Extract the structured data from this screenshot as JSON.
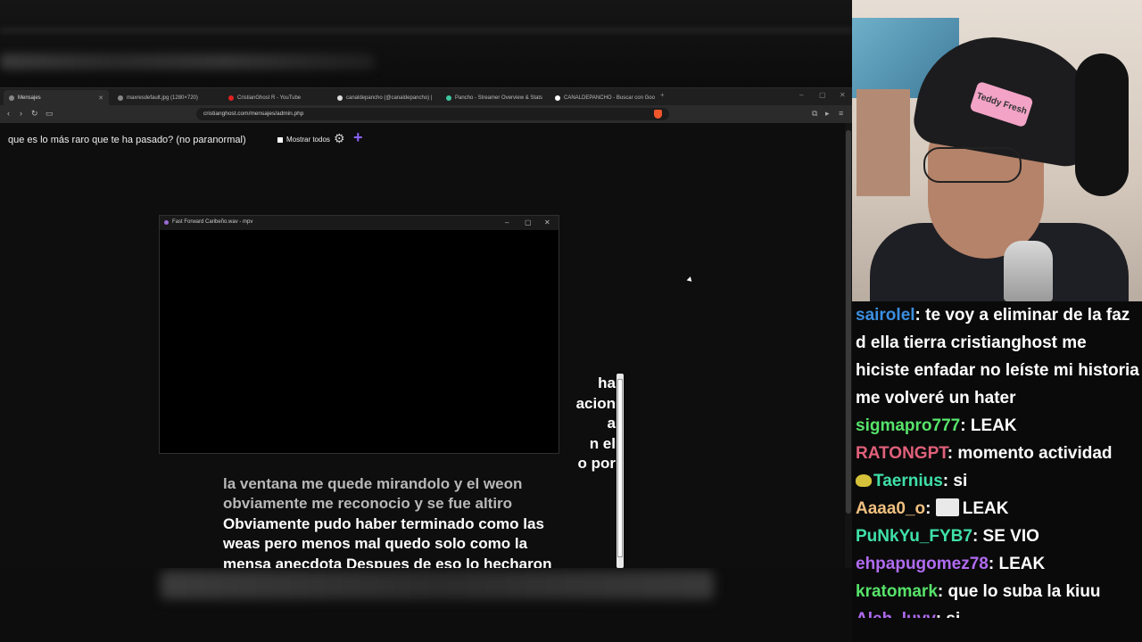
{
  "browser": {
    "tabs": [
      {
        "label": "Mensajes",
        "active": true
      },
      {
        "label": "maxresdefault.jpg (1280×720)"
      },
      {
        "label": "CristianGhost R - YouTube"
      },
      {
        "label": "canaldepancho (@canaldepancho) |"
      },
      {
        "label": "Pancho - Streamer Overview & Stats"
      },
      {
        "label": "CANALDEPANCHO - Buscar con Goo"
      }
    ],
    "url": "cristianghost.com/mensajes/admin.php"
  },
  "page": {
    "question": "que es lo más raro que te ha pasado? (no paranormal)",
    "mostrar_label": "Mostrar todos",
    "message_lines": [
      {
        "text": "ha",
        "dim": false
      },
      {
        "text": "acion",
        "dim": false
      },
      {
        "text": "a",
        "dim": false
      },
      {
        "text": "n el",
        "dim": false
      },
      {
        "text": "o por",
        "dim": false
      },
      {
        "text": "la ventana me quede mirandolo y el weon",
        "dim": true
      },
      {
        "text": "obviamente me reconocio y se fue altiro",
        "dim": true
      },
      {
        "text": "Obviamente pudo haber terminado como las",
        "dim": false
      },
      {
        "text": "weas pero menos mal quedo solo como la",
        "dim": false
      },
      {
        "text": "mensa anecdota Despues de eso lo hecharon",
        "dim": false
      }
    ]
  },
  "mpv": {
    "title": "Fast Forward Caribeño.wav - mpv"
  },
  "webcam": {
    "beanie_text": "Teddy Fresh"
  },
  "chat": {
    "messages": [
      {
        "user": "sairolel",
        "color": "#3a8fe0",
        "text": "te voy a eliminar de la faz d ella tierra cristianghost me hiciste enfadar no leíste mi historia me volveré un hater"
      },
      {
        "user": "sigmapro777",
        "color": "#57e36a",
        "text": "LEAK"
      },
      {
        "user": "RATONGPT",
        "color": "#e0607a",
        "text": "momento actividad"
      },
      {
        "user": "Taernius",
        "color": "#3fe0a8",
        "text": "si",
        "badge": true
      },
      {
        "user": "Aaaa0_o",
        "color": "#f0c080",
        "text": "LEAK",
        "emote": true
      },
      {
        "user": "PuNkYu_FYB7",
        "color": "#3fe0a8",
        "text": "SE VIO"
      },
      {
        "user": "ehpapugomez78",
        "color": "#b06bf0",
        "text": "LEAK"
      },
      {
        "user": "kratomark",
        "color": "#57e36a",
        "text": "que lo suba la kiuu"
      },
      {
        "user": "Aleh_luvv",
        "color": "#b06bf0",
        "text": "si",
        "cut": true
      }
    ]
  }
}
